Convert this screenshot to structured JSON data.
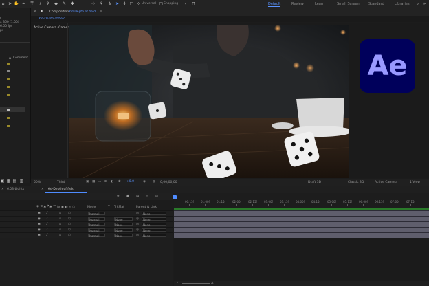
{
  "toolbar": {
    "universal_label": "Universal",
    "snapping_label": "Snapping",
    "workspaces": [
      "Default",
      "Review",
      "Learn",
      "Small Screen",
      "Standard",
      "Libraries"
    ]
  },
  "project": {
    "info_lines": [
      "r",
      "x 360 (1.00)",
      "6.00 fps",
      "ps"
    ],
    "comment_header": "Comment"
  },
  "composition": {
    "title": "Composition",
    "comp_name": "6d-Depth of field",
    "tab_label": "6d-Depth of field",
    "camera_label": "Active Camera (Camera 1)"
  },
  "viewer_bar": {
    "zoom": "50%",
    "resolution": "Third",
    "exposure": "+0.0",
    "timecode": "0;00;00;00",
    "renderer": "Draft 3D",
    "renderer_mode": "Classic 3D",
    "camera": "Active Camera",
    "views": "1 View"
  },
  "timeline": {
    "tabs": [
      "6.03-Lights",
      "6d-Depth of field"
    ],
    "columns": {
      "mode": "Mode",
      "t": "T",
      "trkmat": "TrkMat",
      "parent": "Parent & Link"
    },
    "layers": [
      {
        "mode": "Normal",
        "trkmat": "",
        "parent": "None"
      },
      {
        "mode": "Normal",
        "trkmat": "None",
        "parent": "None"
      },
      {
        "mode": "Normal",
        "trkmat": "None",
        "parent": "None"
      },
      {
        "mode": "Normal",
        "trkmat": "None",
        "parent": "None"
      },
      {
        "mode": "Normal",
        "trkmat": "None",
        "parent": "None"
      }
    ],
    "ruler": [
      "00:15f",
      "01:00f",
      "01:15f",
      "02:00f",
      "02:15f",
      "03:00f",
      "03:15f",
      "04:00f",
      "04:15f",
      "05:00f",
      "05:15f",
      "06:00f",
      "06:15f",
      "07:00f",
      "07:15f"
    ]
  },
  "logo": {
    "text": "Ae",
    "bg": "#00005b",
    "fg": "#9999ff"
  },
  "colors": {
    "accent": "#4f8cff",
    "layer_bar": "#5f5e6c",
    "work_area": "#2a7a2a"
  }
}
